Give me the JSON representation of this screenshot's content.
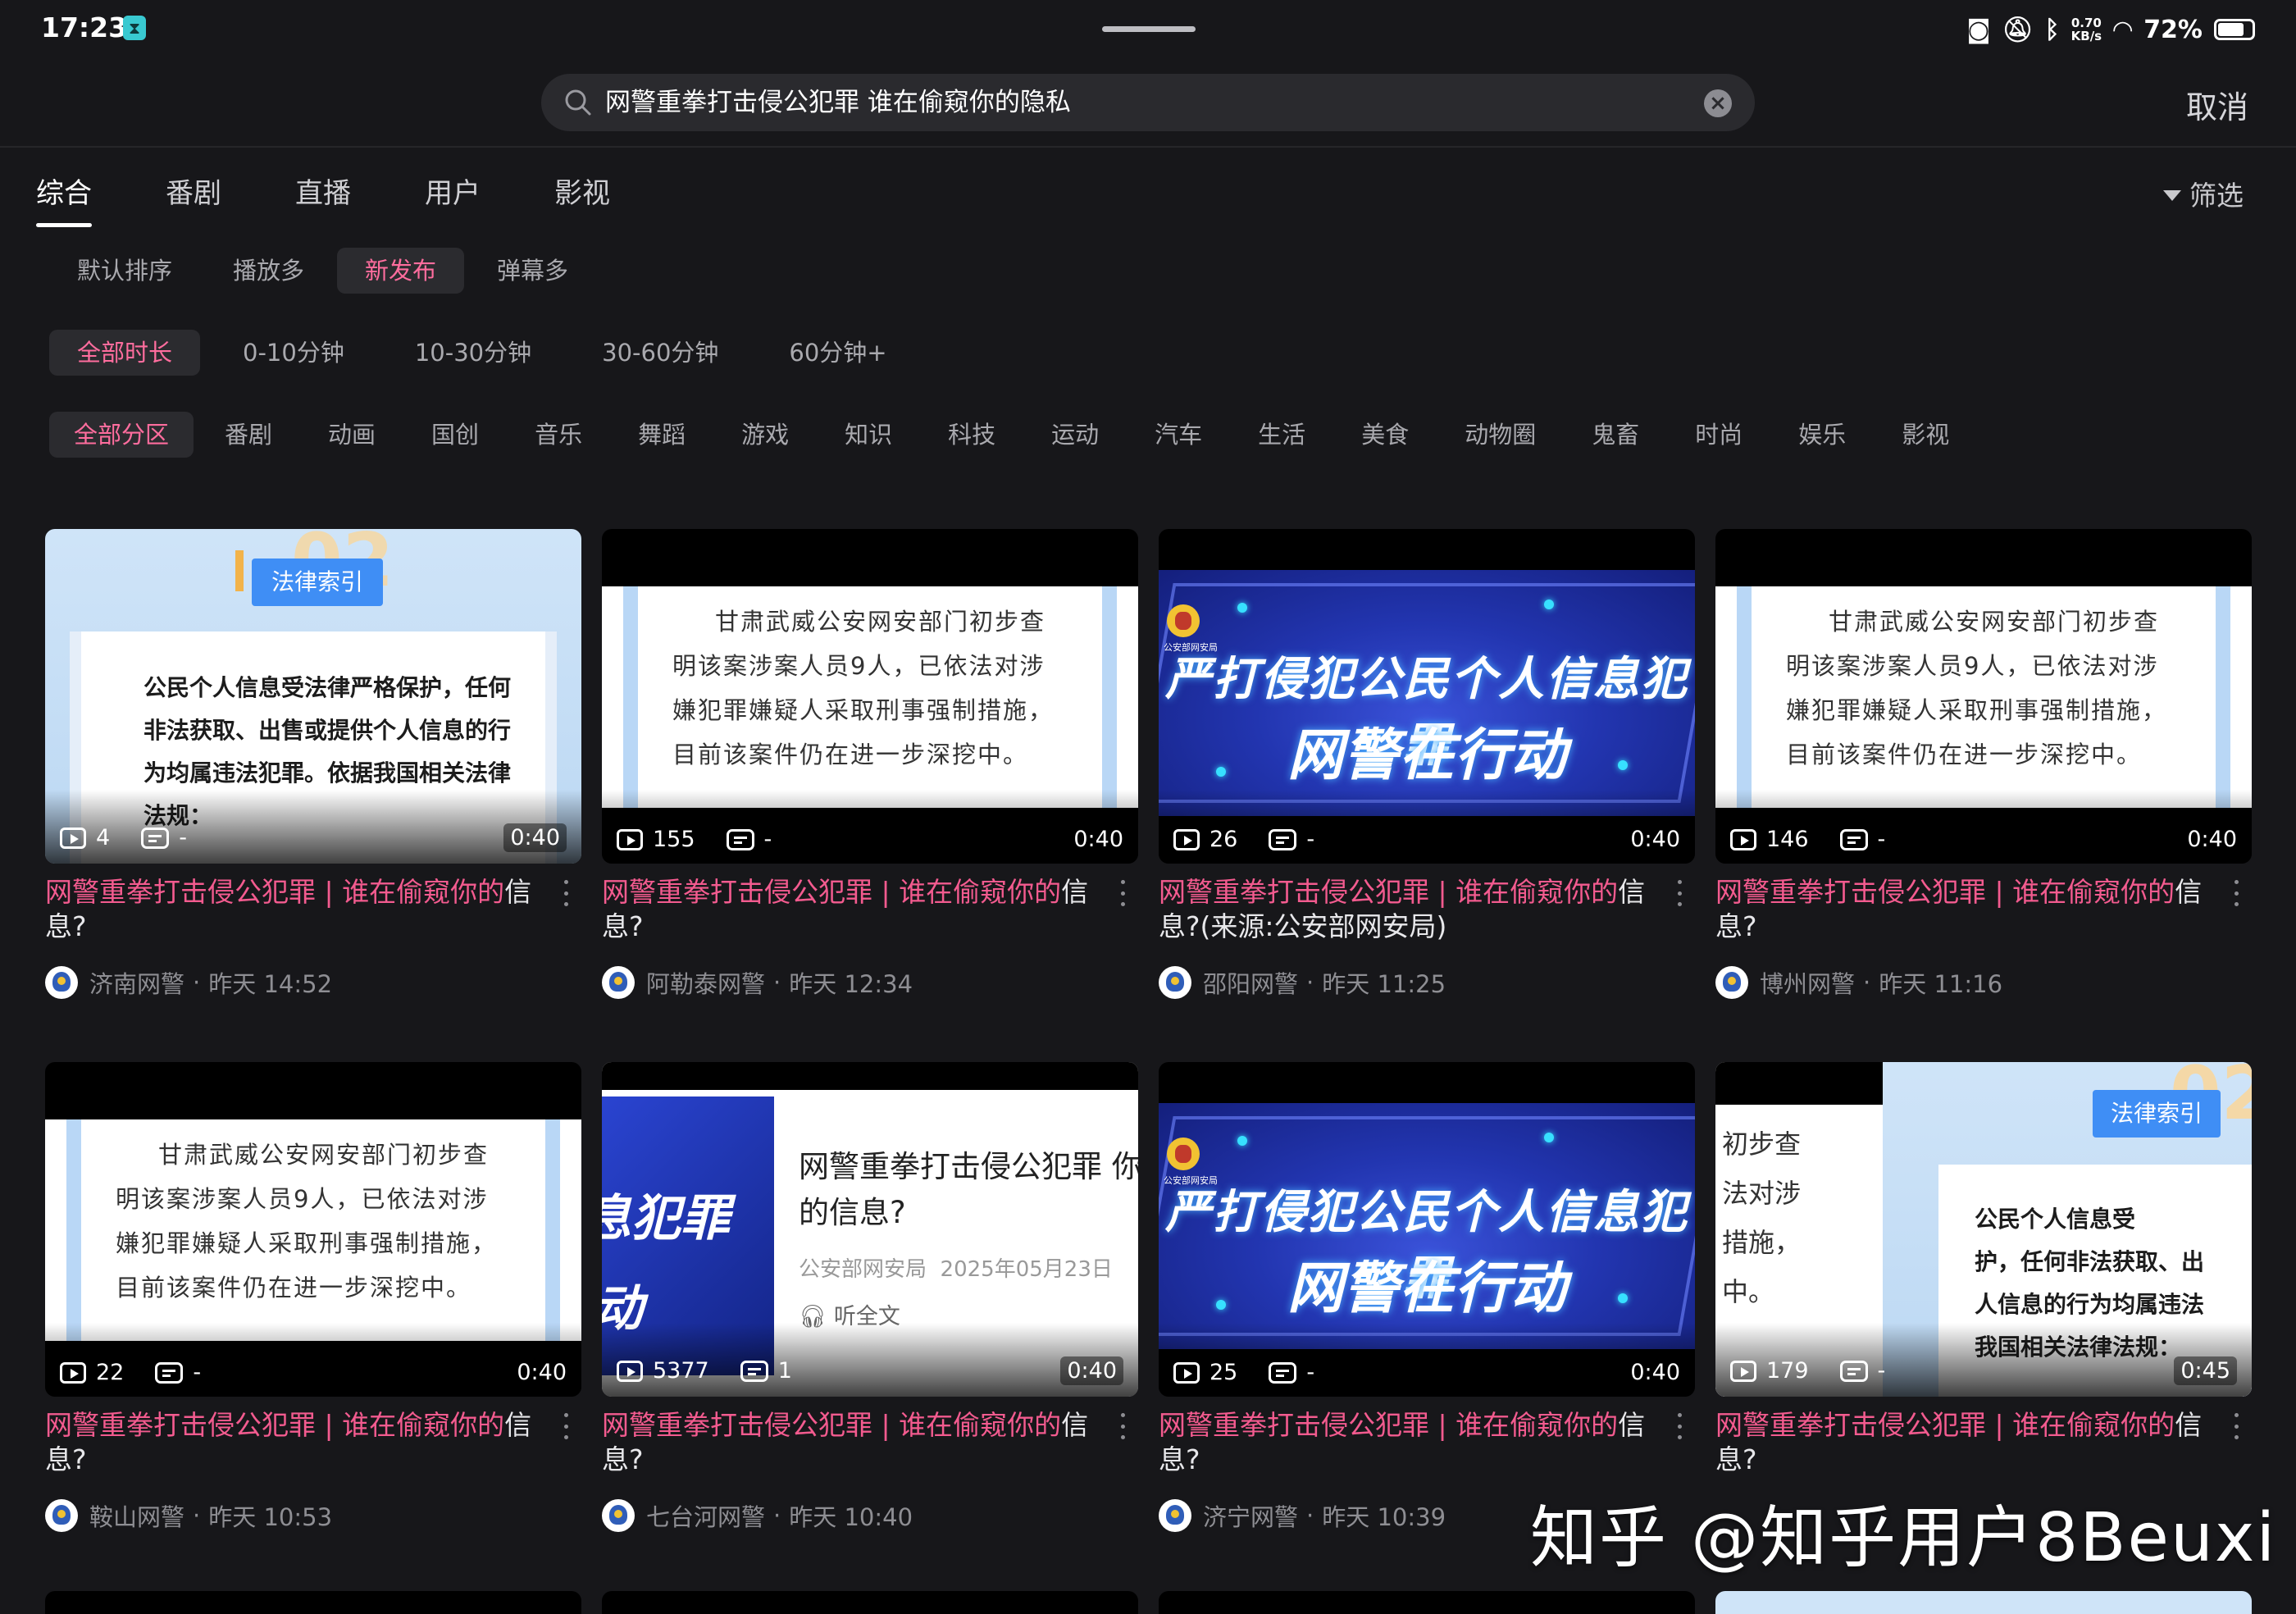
{
  "status": {
    "time": "17:23",
    "net_speed_top": "0.70",
    "net_speed_bottom": "KB/s",
    "battery": "72%"
  },
  "search": {
    "query": "网警重拳打击侵公犯罪 谁在偷窥你的隐私",
    "cancel_label": "取消"
  },
  "tabs": [
    "综合",
    "番剧",
    "直播",
    "用户",
    "影视"
  ],
  "filter_label": "筛选",
  "sort_options": [
    "默认排序",
    "播放多",
    "新发布",
    "弹幕多"
  ],
  "duration_options": [
    "全部时长",
    "0-10分钟",
    "10-30分钟",
    "30-60分钟",
    "60分钟+"
  ],
  "category_options": [
    "全部分区",
    "番剧",
    "动画",
    "国创",
    "音乐",
    "舞蹈",
    "游戏",
    "知识",
    "科技",
    "运动",
    "汽车",
    "生活",
    "美食",
    "动物圈",
    "鬼畜",
    "时尚",
    "娱乐",
    "影视"
  ],
  "thumb_text": {
    "law_tag": "法律索引",
    "law_num": "02",
    "law_body": "公民个人信息受法律严格保护，任何非法获取、出售或提供个人信息的行为均属违法犯罪。依据我国相关法律法规：",
    "law_body_cropped": "公民个人信息受\n护，任何非法获取、出\n人信息的行为均属违法\n我国相关法律法规：",
    "case_l1": "甘肃武威公安网安部门初步查",
    "case_l2": "明该案涉案人员9人，已依法对涉",
    "case_l3": "嫌犯罪嫌疑人采取刑事强制措施，",
    "case_l4": "目前该案件仍在进一步深挖中。",
    "case_cropped": "初步查\n法对涉\n措施，\n中。",
    "banner_h1": "严打侵犯公民个人信息犯罪",
    "banner_h2": "网警在行动",
    "banner_org": "公安部网安局",
    "article_title": "网警重拳打击侵公犯罪 你的信息?",
    "article_src": "公安部网安局",
    "article_date": "2025年05月23日",
    "article_listen": "听全文",
    "article_left1": "息犯罪",
    "article_left2": "动"
  },
  "videos": [
    {
      "type": "A",
      "plays": "4",
      "danmaku": "-",
      "duration": "0:40",
      "title_hl1": "网警重拳打击侵公犯罪",
      "sep": "|",
      "title_hl2": "谁在偷窥你",
      "title_hl3": "的",
      "title_rest": "信息?",
      "author": "济南网警",
      "dot": "·",
      "time": "昨天 14:52"
    },
    {
      "type": "B",
      "plays": "155",
      "danmaku": "-",
      "duration": "0:40",
      "title_hl1": "网警重拳打击侵公犯罪",
      "sep": "|",
      "title_hl2": "谁在偷窥你",
      "title_hl3": "的",
      "title_rest": "信息?",
      "author": "阿勒泰网警",
      "dot": "·",
      "time": "昨天 12:34"
    },
    {
      "type": "C",
      "plays": "26",
      "danmaku": "-",
      "duration": "0:40",
      "title_hl1": "网警重拳打击侵公犯罪",
      "sep": "|",
      "title_hl2": "谁在偷窥你",
      "title_hl3": "的",
      "title_rest": "信息?(来源:公安部网安局)",
      "author": "邵阳网警",
      "dot": "·",
      "time": "昨天 11:25"
    },
    {
      "type": "B",
      "plays": "146",
      "danmaku": "-",
      "duration": "0:40",
      "title_hl1": "网警重拳打击侵公犯罪",
      "sep": "|",
      "title_hl2": "谁在偷窥你",
      "title_hl3": "的",
      "title_rest": "信息?",
      "author": "博州网警",
      "dot": "·",
      "time": "昨天 11:16"
    },
    {
      "type": "B",
      "plays": "22",
      "danmaku": "-",
      "duration": "0:40",
      "title_hl1": "网警重拳打击侵公犯罪",
      "sep": "|",
      "title_hl2": "谁在偷窥你",
      "title_hl3": "的",
      "title_rest": "信息?",
      "author": "鞍山网警",
      "dot": "·",
      "time": "昨天 10:53"
    },
    {
      "type": "D",
      "plays": "5377",
      "danmaku": "1",
      "duration": "0:40",
      "title_hl1": "网警重拳打击侵公犯罪",
      "sep": "|",
      "title_hl2": "谁在偷窥你",
      "title_hl3": "的",
      "title_rest": "信息?",
      "author": "七台河网警",
      "dot": "·",
      "time": "昨天 10:40"
    },
    {
      "type": "C",
      "plays": "25",
      "danmaku": "-",
      "duration": "0:40",
      "title_hl1": "网警重拳打击侵公犯罪",
      "sep": "|",
      "title_hl2": "谁在偷窥你",
      "title_hl3": "的",
      "title_rest": "信息?",
      "author": "济宁网警",
      "dot": "·",
      "time": "昨天 10:39"
    },
    {
      "type": "E",
      "plays": "179",
      "danmaku": "-",
      "duration": "0:45",
      "title_hl1": "网警重拳打击侵公犯罪",
      "sep": "|",
      "title_hl2": "谁在偷窥你",
      "title_hl3": "的",
      "title_rest": "信息?",
      "author": "",
      "dot": "",
      "time": ""
    }
  ],
  "watermark": "知乎 @知乎用户8Beuxi",
  "colors": {
    "accent": "#f35b8f",
    "chip_active_text": "#ff6d9e",
    "background": "#17171a"
  }
}
